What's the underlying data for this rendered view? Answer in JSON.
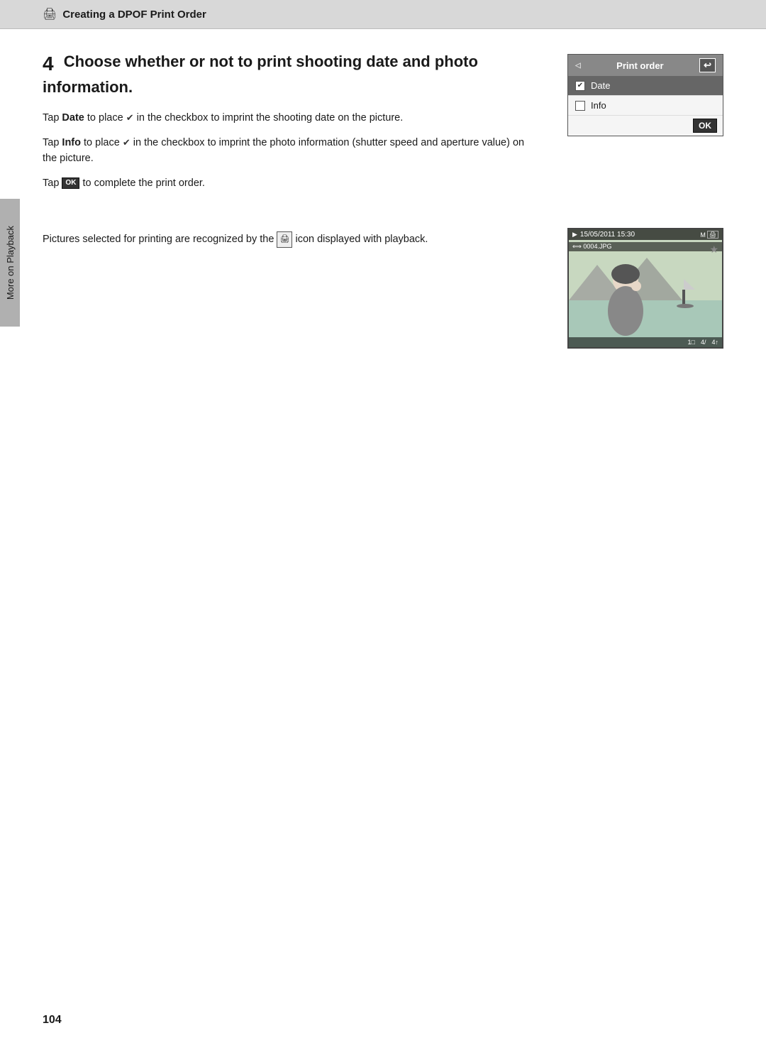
{
  "header": {
    "icon": "🖨",
    "title": "Creating a DPOF Print Order"
  },
  "sidebar": {
    "label": "More on Playback"
  },
  "step4": {
    "number": "4",
    "heading": "Choose whether or not to print shooting date and photo information.",
    "para1_prefix": "Tap ",
    "para1_bold": "Date",
    "para1_suffix": " to place ✔ in the checkbox to imprint the shooting date on the picture.",
    "para2_prefix": "Tap ",
    "para2_bold": "Info",
    "para2_suffix": " to place ✔ in the checkbox to imprint the photo information (shutter speed and aperture value) on the picture.",
    "para3_prefix": "Tap ",
    "para3_ok": "OK",
    "para3_suffix": " to complete the print order."
  },
  "dialog": {
    "title": "Print order",
    "back_icon": "↩",
    "left_indicator": "◁",
    "rows": [
      {
        "id": "date",
        "label": "Date",
        "checked": true,
        "selected": true
      },
      {
        "id": "info",
        "label": "Info",
        "checked": false,
        "selected": false
      }
    ],
    "ok_label": "OK"
  },
  "playback": {
    "text_prefix": "Pictures selected for printing are recognized by the ",
    "text_suffix": " icon displayed with playback."
  },
  "preview": {
    "date": "15/05/2011 15:30",
    "mode_icons": "M⊡",
    "filename": "0004.JPG",
    "star": "★",
    "footer_left": "1□",
    "footer_mid": "4/",
    "footer_right": "4↑"
  },
  "page_number": "104"
}
